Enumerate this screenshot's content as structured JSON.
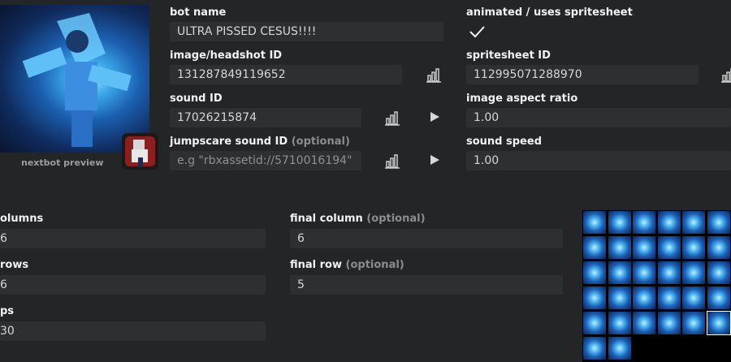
{
  "preview": {
    "caption": "nextbot preview"
  },
  "bot_name": {
    "label": "bot name",
    "value": "ULTRA PISSED CESUS!!!!"
  },
  "animated": {
    "label": "animated / uses spritesheet",
    "checked": true
  },
  "image_id": {
    "label": "image/headshot ID",
    "value": "131287849119652"
  },
  "spritesheet_id": {
    "label": "spritesheet ID",
    "value": "112995071288970"
  },
  "sound_id": {
    "label": "sound ID",
    "value": "17026215874"
  },
  "aspect_ratio": {
    "label": "image aspect ratio",
    "value": "1.00"
  },
  "jumpscare": {
    "label": "jumpscare sound ID",
    "optional": "(optional)",
    "placeholder": "e.g \"rbxassetid://5710016194\""
  },
  "sound_speed": {
    "label": "sound speed",
    "value": "1.00"
  },
  "columns": {
    "label": "olumns",
    "value": "6"
  },
  "rows": {
    "label": "rows",
    "value": "6"
  },
  "fps": {
    "label": "ps",
    "value": "30"
  },
  "final_column": {
    "label": "final column",
    "optional": "(optional)",
    "value": "6"
  },
  "final_row": {
    "label": "final row",
    "optional": "(optional)",
    "value": "5"
  },
  "icons": {
    "stats": "bar-chart-icon",
    "play": "play-icon",
    "check": "checkmark-icon"
  },
  "colors": {
    "background": "#232527",
    "field": "#2d2f31",
    "accent": "#3aa6e8"
  }
}
